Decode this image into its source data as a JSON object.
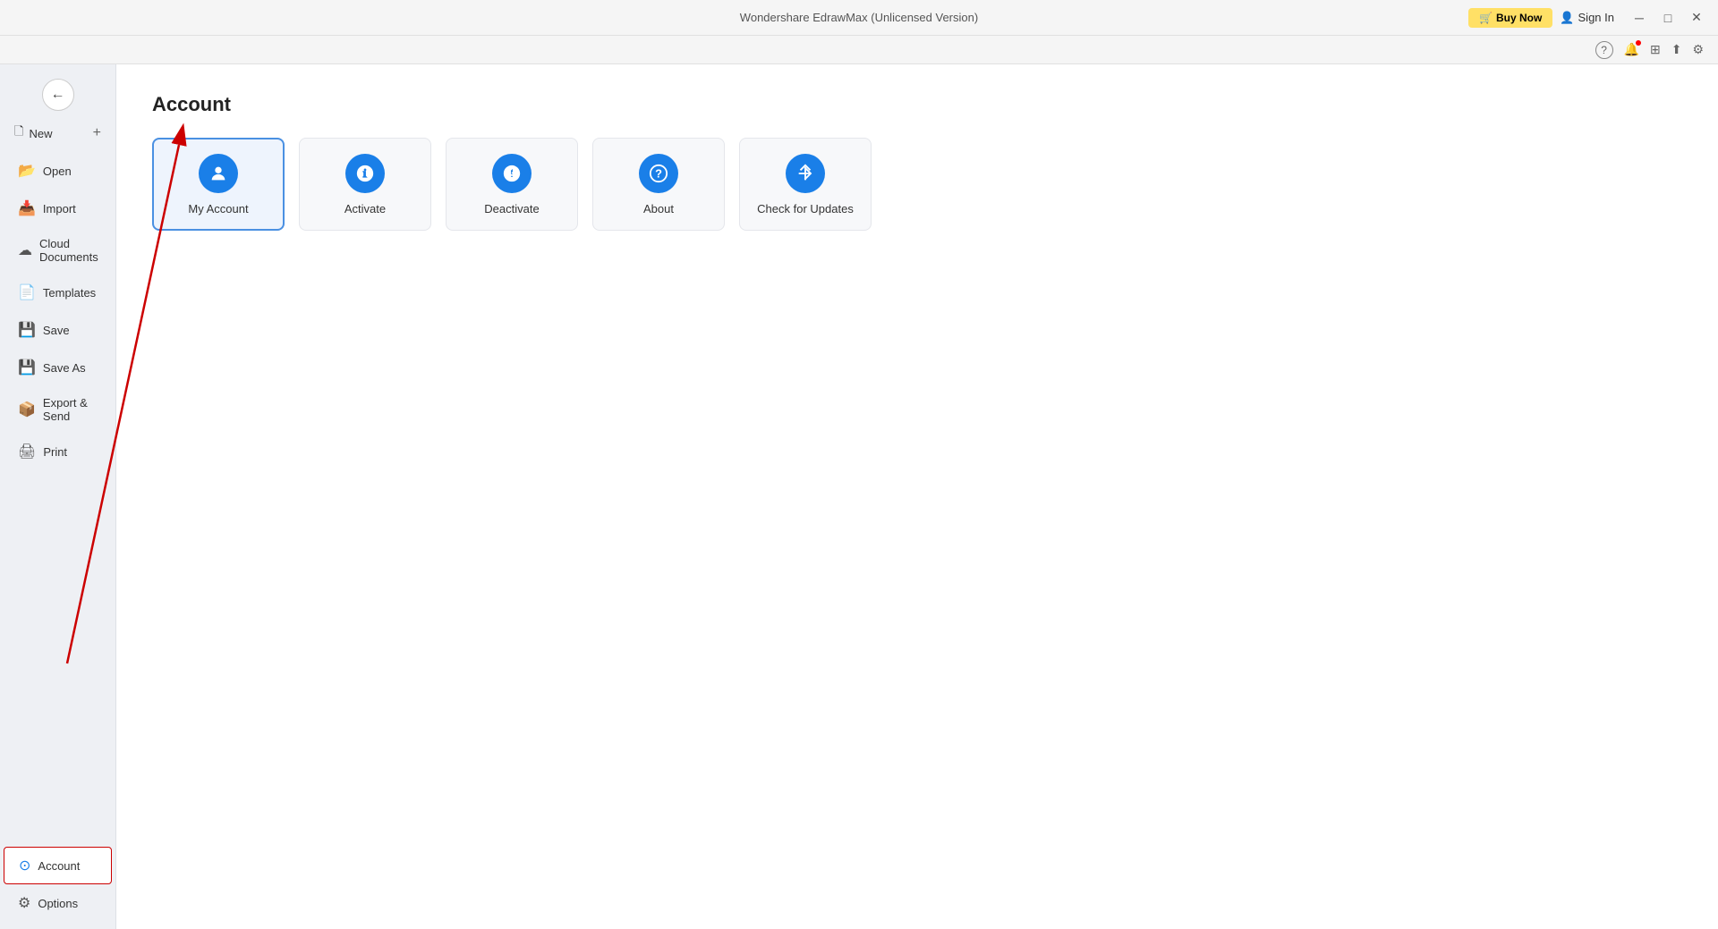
{
  "titlebar": {
    "title": "Wondershare EdrawMax (Unlicensed Version)",
    "buy_now": "Buy Now",
    "sign_in": "Sign In",
    "minimize": "─",
    "restore": "□",
    "close": "✕"
  },
  "toolbar_icons": {
    "help": "?",
    "notification": "🔔",
    "community": "⊞",
    "share": "⬆",
    "settings": "⚙"
  },
  "sidebar": {
    "back_arrow": "←",
    "items": [
      {
        "id": "new",
        "label": "New",
        "icon": "＋",
        "has_plus": true
      },
      {
        "id": "open",
        "label": "Open",
        "icon": "📂"
      },
      {
        "id": "import",
        "label": "Import",
        "icon": "📥"
      },
      {
        "id": "cloud",
        "label": "Cloud Documents",
        "icon": "☁"
      },
      {
        "id": "templates",
        "label": "Templates",
        "icon": "📄"
      },
      {
        "id": "save",
        "label": "Save",
        "icon": "💾"
      },
      {
        "id": "save-as",
        "label": "Save As",
        "icon": "💾"
      },
      {
        "id": "export",
        "label": "Export & Send",
        "icon": "📦"
      },
      {
        "id": "print",
        "label": "Print",
        "icon": "🖨"
      }
    ],
    "bottom_items": [
      {
        "id": "account",
        "label": "Account",
        "icon": "⊙",
        "active": true
      },
      {
        "id": "options",
        "label": "Options",
        "icon": "⚙"
      }
    ]
  },
  "content": {
    "title": "Account",
    "cards": [
      {
        "id": "my-account",
        "label": "My Account",
        "icon": "👤",
        "selected": true
      },
      {
        "id": "activate",
        "label": "Activate",
        "icon": "⚡"
      },
      {
        "id": "deactivate",
        "label": "Deactivate",
        "icon": "🔄"
      },
      {
        "id": "about",
        "label": "About",
        "icon": "?"
      },
      {
        "id": "check-updates",
        "label": "Check for Updates",
        "icon": "↑"
      }
    ]
  }
}
